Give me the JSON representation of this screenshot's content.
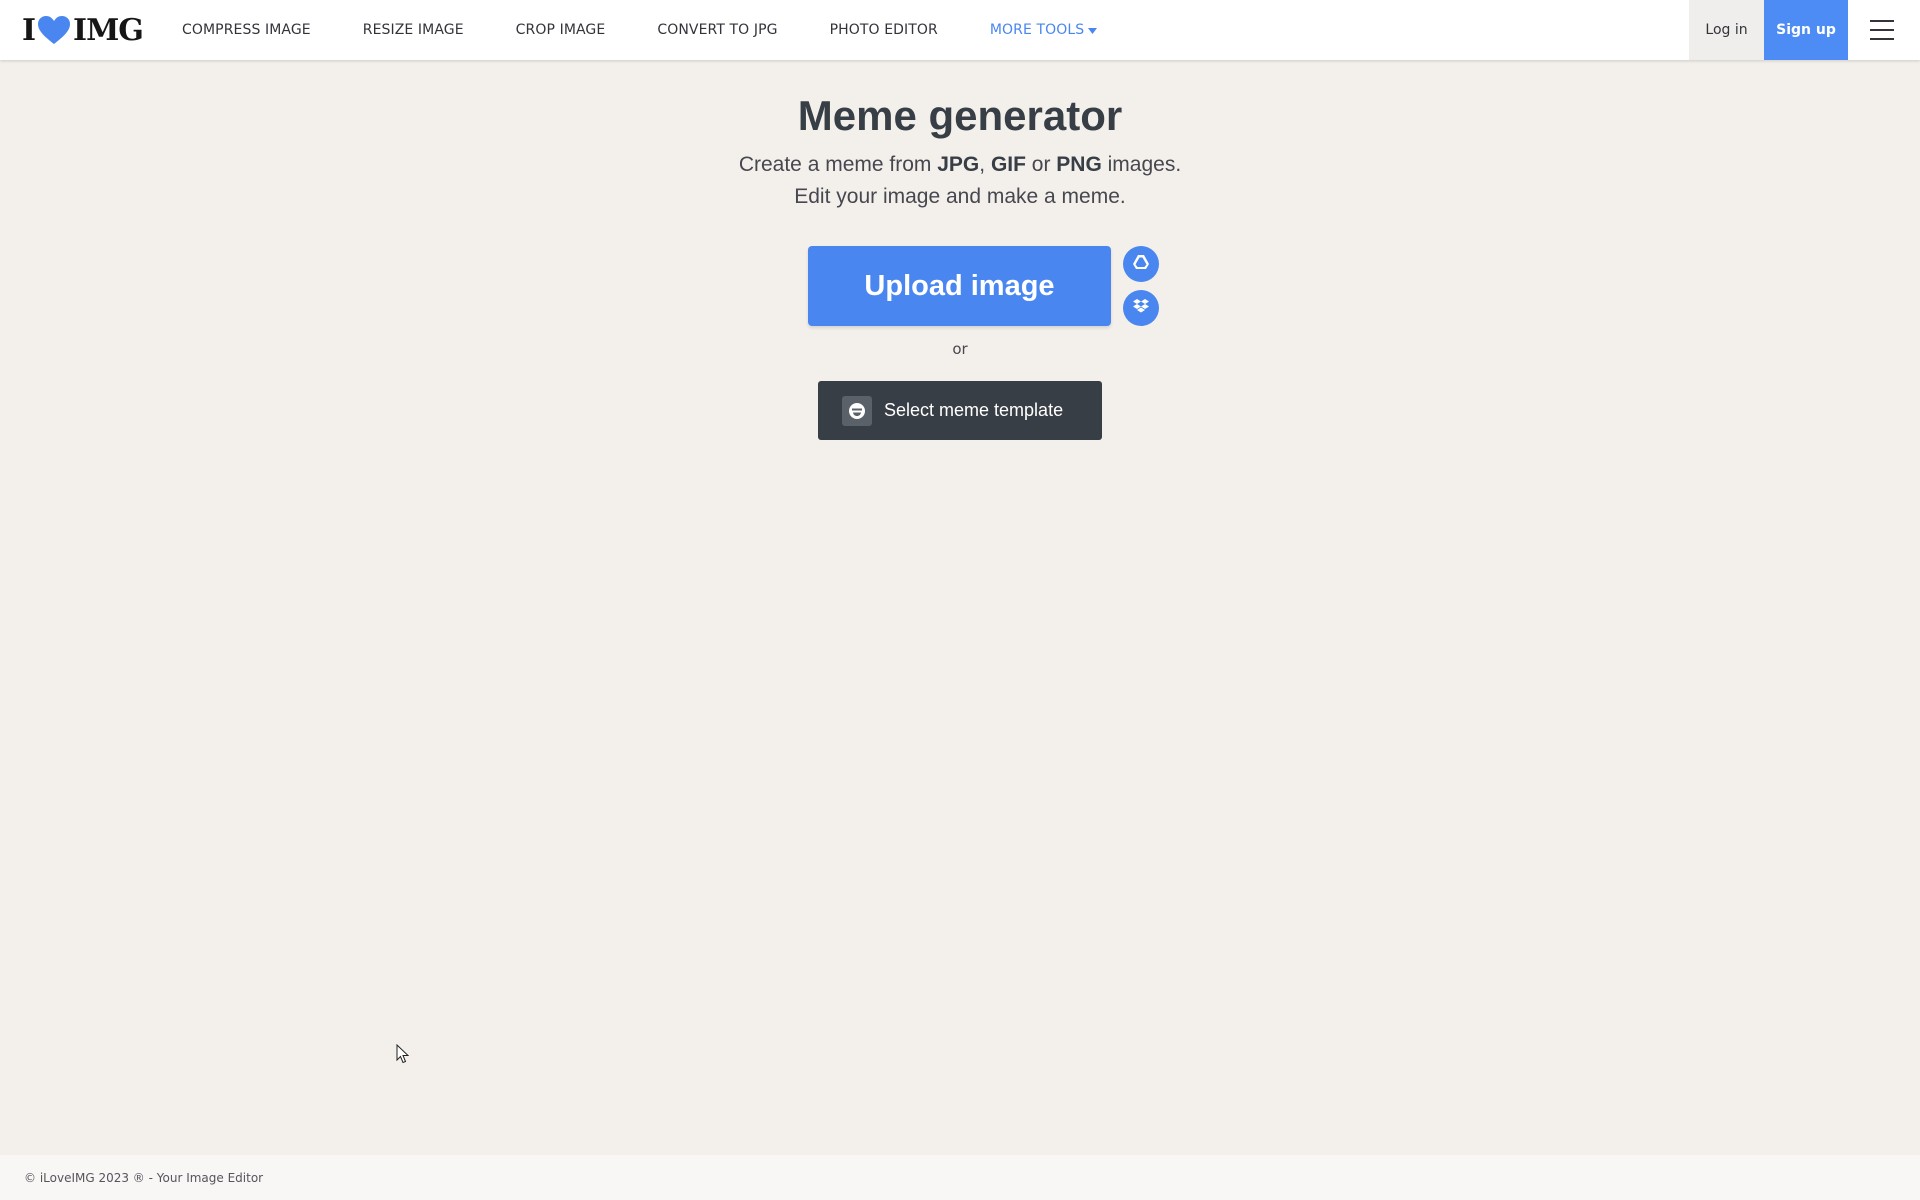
{
  "header": {
    "logo": {
      "left": "I",
      "right": "IMG"
    },
    "nav": [
      {
        "label": "COMPRESS IMAGE"
      },
      {
        "label": "RESIZE IMAGE"
      },
      {
        "label": "CROP IMAGE"
      },
      {
        "label": "CONVERT TO JPG"
      },
      {
        "label": "PHOTO EDITOR"
      }
    ],
    "more_tools_label": "MORE TOOLS",
    "login_label": "Log in",
    "signup_label": "Sign up"
  },
  "main": {
    "title": "Meme generator",
    "subtitle": {
      "prefix": "Create a meme from ",
      "format1": "JPG",
      "sep1": ", ",
      "format2": "GIF",
      "sep2": " or ",
      "format3": "PNG",
      "suffix": " images.",
      "line2": "Edit your image and make a meme."
    },
    "upload_label": "Upload image",
    "or_label": "or",
    "template_label": "Select meme template"
  },
  "icons": {
    "logo_heart": "heart-icon",
    "gdrive": "google-drive-icon",
    "dropbox": "dropbox-icon",
    "template": "smiley-icon",
    "menu": "hamburger-menu-icon",
    "caret": "caret-down-icon"
  },
  "colors": {
    "brand_blue": "#4a86f0",
    "dark": "#383e45",
    "background": "#f3f0ec"
  },
  "footer": {
    "text": "© iLoveIMG 2023 ® - Your Image Editor"
  }
}
